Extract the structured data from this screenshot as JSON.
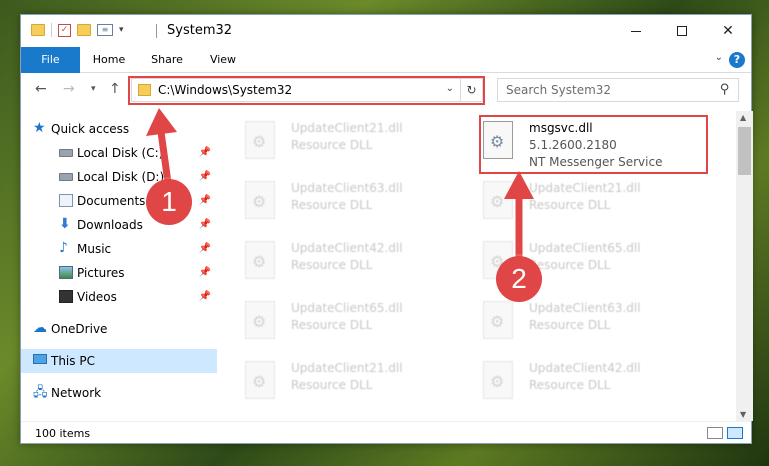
{
  "window": {
    "title": "System32"
  },
  "ribbon": {
    "tabs": [
      "File",
      "Home",
      "Share",
      "View"
    ],
    "help": "?"
  },
  "address_bar": {
    "path": "C:\\Windows\\System32"
  },
  "search": {
    "placeholder": "Search System32"
  },
  "sidebar": {
    "quick_access": "Quick access",
    "items": [
      {
        "label": "Local Disk (C:)",
        "icon": "disk-icon",
        "pinned": true
      },
      {
        "label": "Local Disk (D:)",
        "icon": "disk-icon",
        "pinned": true
      },
      {
        "label": "Documents",
        "icon": "documents-icon",
        "pinned": true
      },
      {
        "label": "Downloads",
        "icon": "downloads-icon",
        "pinned": true
      },
      {
        "label": "Music",
        "icon": "music-icon",
        "pinned": true
      },
      {
        "label": "Pictures",
        "icon": "pictures-icon",
        "pinned": true
      },
      {
        "label": "Videos",
        "icon": "videos-icon",
        "pinned": true
      }
    ],
    "onedrive": "OneDrive",
    "this_pc": "This PC",
    "network": "Network"
  },
  "files": {
    "left_column": [
      {
        "name": "UpdateClient21.dll",
        "type": "Resource DLL"
      },
      {
        "name": "UpdateClient63.dll",
        "type": "Resource DLL"
      },
      {
        "name": "UpdateClient42.dll",
        "type": "Resource DLL"
      },
      {
        "name": "UpdateClient65.dll",
        "type": "Resource DLL"
      },
      {
        "name": "UpdateClient21.dll",
        "type": "Resource DLL"
      }
    ],
    "right_column": [
      {
        "name": "msgsvc.dll",
        "version": "5.1.2600.2180",
        "description": "NT Messenger Service"
      },
      {
        "name": "UpdateClient21.dll",
        "type": "Resource DLL"
      },
      {
        "name": "UpdateClient65.dll",
        "type": "Resource DLL"
      },
      {
        "name": "UpdateClient63.dll",
        "type": "Resource DLL"
      },
      {
        "name": "UpdateClient42.dll",
        "type": "Resource DLL"
      }
    ]
  },
  "status": {
    "item_count": "100 items"
  },
  "annotations": {
    "step1": "1",
    "step2": "2",
    "color": "#e04646"
  }
}
